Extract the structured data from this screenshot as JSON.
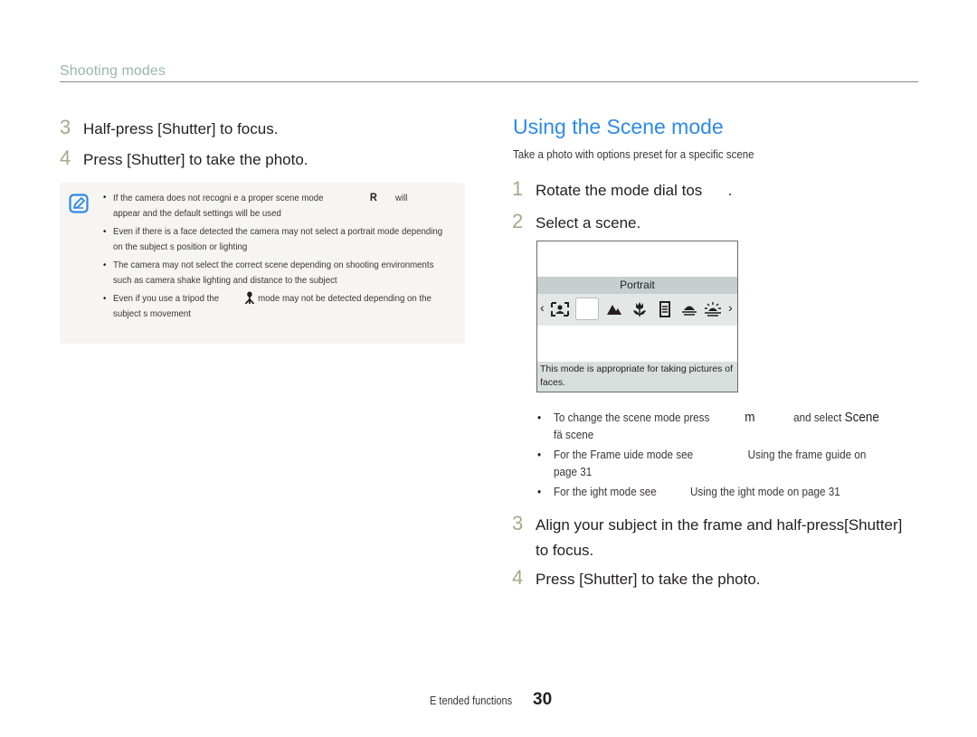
{
  "header": {
    "section": "Shooting modes"
  },
  "left": {
    "steps": [
      {
        "num": "3",
        "text": "Half-press [Shutter] to focus."
      },
      {
        "num": "4",
        "text": "Press [Shutter] to take the photo."
      }
    ],
    "note": {
      "icon": "note-pencil-icon",
      "items": [
        {
          "before": "If the camera does not recogni e a proper scene mode",
          "glyph": "R",
          "after": "will",
          "line2": "appear and the default settings will be used"
        },
        {
          "text": "Even if there is a face detected  the camera may not select a portrait mode depending on the subject s position or lighting"
        },
        {
          "text": "The camera may not select the correct scene depending on shooting environments  such as camera shake  lighting  and distance to the subject"
        },
        {
          "before": "Even if you use a tripod  the",
          "icon": "tripod-icon",
          "after": "mode may not be detected depending on the subject s movement"
        }
      ]
    }
  },
  "right": {
    "title": "Using the Scene mode",
    "subtitle": "Take a photo with options preset for a specific scene",
    "steps": [
      {
        "num": "1",
        "text": "Rotate the mode dial tos      ."
      },
      {
        "num": "2",
        "text": "Select a scene."
      },
      {
        "num": "3",
        "text": "Align your subject in the frame and half-press[Shutter]",
        "text2": "to focus."
      },
      {
        "num": "4",
        "text": "Press [Shutter] to take the photo."
      }
    ],
    "screen": {
      "selected_label": "Portrait",
      "description": "This mode is appropriate for taking pictures of faces.",
      "icons": [
        "left-arrow-icon",
        "smart-portrait-icon",
        "selected-blank-icon",
        "landscape-icon",
        "macro-flower-icon",
        "text-document-icon",
        "sunset-icon",
        "dawn-icon",
        "right-arrow-icon"
      ]
    },
    "tips": [
      {
        "before": "To change the scene mode  press",
        "key": "m",
        "middle": "and select",
        "strong": "Scene",
        "line2": "fä scene"
      },
      {
        "text": "For the Frame  uide mode  see",
        "link": "Using the frame guide  on",
        "line2": "page 31"
      },
      {
        "text": "For the  ight mode  see",
        "link": "Using the  ight mode  on page 31"
      }
    ]
  },
  "footer": {
    "label": "E tended functions",
    "page": "30"
  }
}
